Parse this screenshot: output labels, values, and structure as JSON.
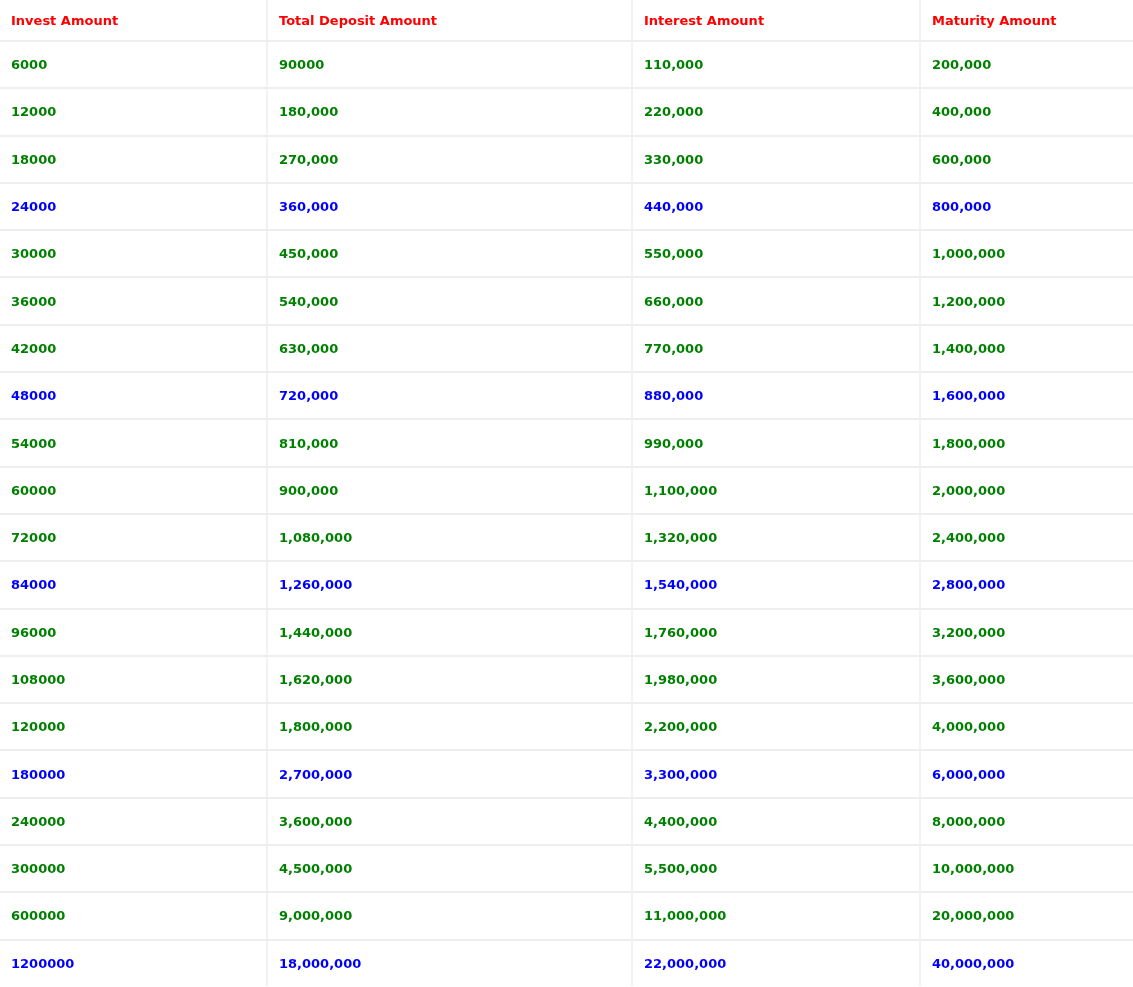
{
  "table": {
    "columns": [
      "Invest Amount",
      "Total Deposit Amount",
      "Interest Amount",
      "Maturity Amount"
    ],
    "rows": [
      {
        "cells": [
          "6000",
          "90000",
          "110,000",
          "200,000"
        ],
        "color": "#008000"
      },
      {
        "cells": [
          "12000",
          "180,000",
          "220,000",
          "400,000"
        ],
        "color": "#008000"
      },
      {
        "cells": [
          "18000",
          "270,000",
          "330,000",
          "600,000"
        ],
        "color": "#008000"
      },
      {
        "cells": [
          "24000",
          "360,000",
          "440,000",
          "800,000"
        ],
        "color": "#0000ff"
      },
      {
        "cells": [
          "30000",
          "450,000",
          "550,000",
          "1,000,000"
        ],
        "color": "#008000"
      },
      {
        "cells": [
          "36000",
          "540,000",
          "660,000",
          "1,200,000"
        ],
        "color": "#008000"
      },
      {
        "cells": [
          "42000",
          "630,000",
          "770,000",
          "1,400,000"
        ],
        "color": "#008000"
      },
      {
        "cells": [
          "48000",
          "720,000",
          "880,000",
          "1,600,000"
        ],
        "color": "#0000ff"
      },
      {
        "cells": [
          "54000",
          "810,000",
          "990,000",
          "1,800,000"
        ],
        "color": "#008000"
      },
      {
        "cells": [
          "60000",
          "900,000",
          "1,100,000",
          "2,000,000"
        ],
        "color": "#008000"
      },
      {
        "cells": [
          "72000",
          "1,080,000",
          "1,320,000",
          "2,400,000"
        ],
        "color": "#008000"
      },
      {
        "cells": [
          "84000",
          "1,260,000",
          "1,540,000",
          "2,800,000"
        ],
        "color": "#0000ff"
      },
      {
        "cells": [
          "96000",
          "1,440,000",
          "1,760,000",
          "3,200,000"
        ],
        "color": "#008000"
      },
      {
        "cells": [
          "108000",
          "1,620,000",
          "1,980,000",
          "3,600,000"
        ],
        "color": "#008000"
      },
      {
        "cells": [
          "120000",
          "1,800,000",
          "2,200,000",
          "4,000,000"
        ],
        "color": "#008000"
      },
      {
        "cells": [
          "180000",
          "2,700,000",
          "3,300,000",
          "6,000,000"
        ],
        "color": "#0000ff"
      },
      {
        "cells": [
          "240000",
          "3,600,000",
          "4,400,000",
          "8,000,000"
        ],
        "color": "#008000"
      },
      {
        "cells": [
          "300000",
          "4,500,000",
          "5,500,000",
          "10,000,000"
        ],
        "color": "#008000"
      },
      {
        "cells": [
          "600000",
          "9,000,000",
          "11,000,000",
          "20,000,000"
        ],
        "color": "#008000"
      },
      {
        "cells": [
          "1200000",
          "18,000,000",
          "22,000,000",
          "40,000,000"
        ],
        "color": "#0000ff"
      }
    ]
  }
}
